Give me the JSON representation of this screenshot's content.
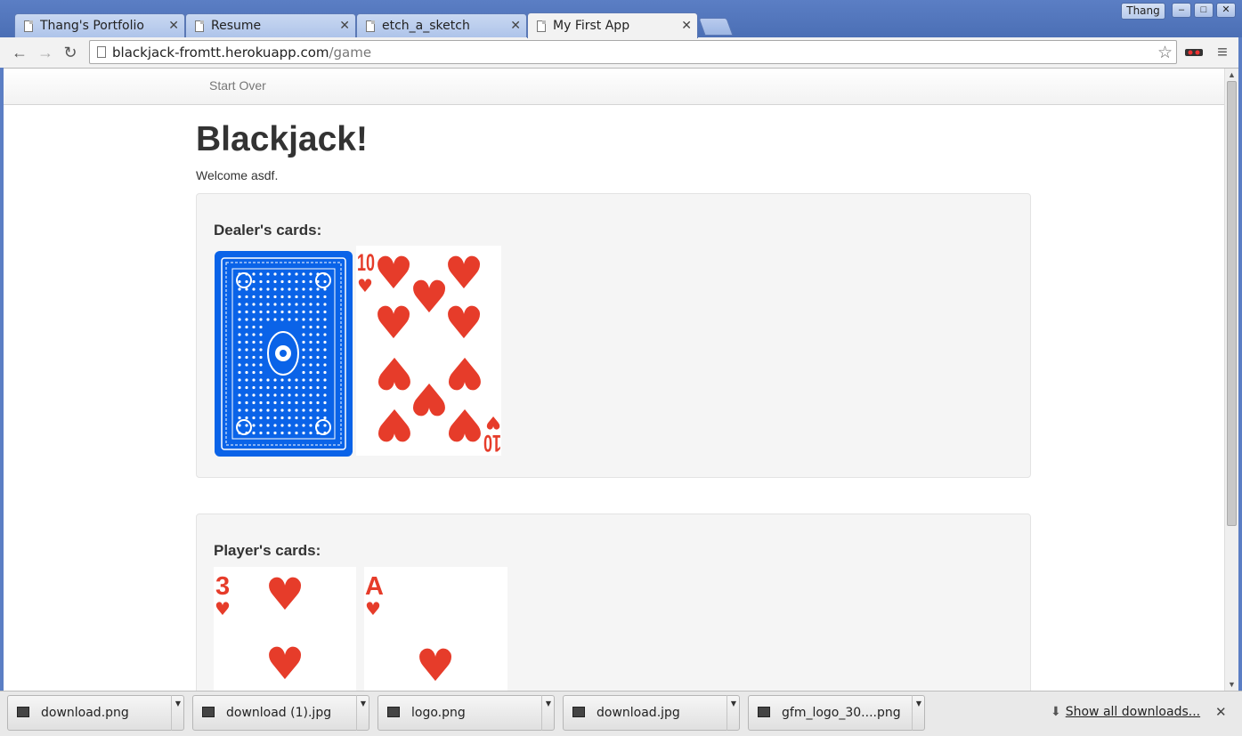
{
  "browser": {
    "tabs": [
      {
        "title": "Thang's Portfolio",
        "active": false
      },
      {
        "title": "Resume",
        "active": false
      },
      {
        "title": "etch_a_sketch",
        "active": false
      },
      {
        "title": "My First App",
        "active": true
      }
    ],
    "user": "Thang",
    "url_host": "blackjack-fromtt.herokuapp.com",
    "url_path": "/game",
    "controls": {
      "back": "←",
      "forward": "→",
      "reload": "↻",
      "star": "☆",
      "menu": "≡",
      "minimize": "–",
      "maximize": "□",
      "close": "✕",
      "tab_close": "✕"
    }
  },
  "page": {
    "nav_link": "Start Over",
    "title": "Blackjack!",
    "welcome": "Welcome asdf.",
    "dealer": {
      "heading": "Dealer's cards:",
      "cards": [
        {
          "kind": "back",
          "color": "#0a63e8"
        },
        {
          "kind": "face",
          "rank": "10",
          "suit": "hearts",
          "suit_symbol": "♥",
          "color": "#e63c2a"
        }
      ]
    },
    "player": {
      "heading": "Player's cards:",
      "cards": [
        {
          "kind": "face",
          "rank": "3",
          "suit": "hearts",
          "suit_symbol": "♥",
          "color": "#e63c2a"
        },
        {
          "kind": "face",
          "rank": "A",
          "suit": "hearts",
          "suit_symbol": "♥",
          "color": "#e63c2a"
        }
      ]
    }
  },
  "downloads": {
    "items": [
      "download.png",
      "download (1).jpg",
      "logo.png",
      "download.jpg",
      "gfm_logo_30....png"
    ],
    "show_all": "Show all downloads...",
    "close": "✕"
  }
}
